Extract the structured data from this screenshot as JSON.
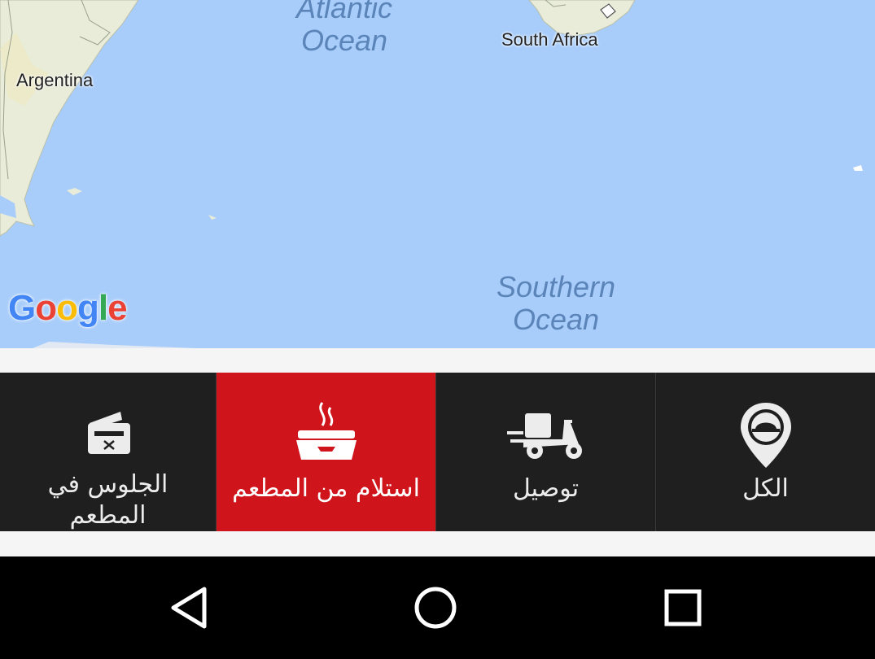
{
  "map": {
    "labels": {
      "argentina": "Argentina",
      "south_africa": "South Africa",
      "atlantic_line1": "Atlantic",
      "atlantic_line2": "Ocean",
      "southern_line1": "Southern",
      "southern_line2": "Ocean"
    },
    "logo": "Google",
    "colors": {
      "water": "#a8cdfb",
      "land": "#e8ecd8"
    }
  },
  "tabs": [
    {
      "label": "الجلوس في المطعم",
      "icon": "dine-in-icon",
      "active": false
    },
    {
      "label": "استلام من المطعم",
      "icon": "pickup-tray-icon",
      "active": true
    },
    {
      "label": "توصيل",
      "icon": "delivery-scooter-icon",
      "active": false
    },
    {
      "label": "الكل",
      "icon": "location-pin-icon",
      "active": false
    }
  ],
  "colors": {
    "accent": "#d0141c",
    "tabbar_bg": "#1f1f1f"
  },
  "navbar": {
    "buttons": [
      "back-icon",
      "home-icon",
      "recents-icon"
    ]
  }
}
